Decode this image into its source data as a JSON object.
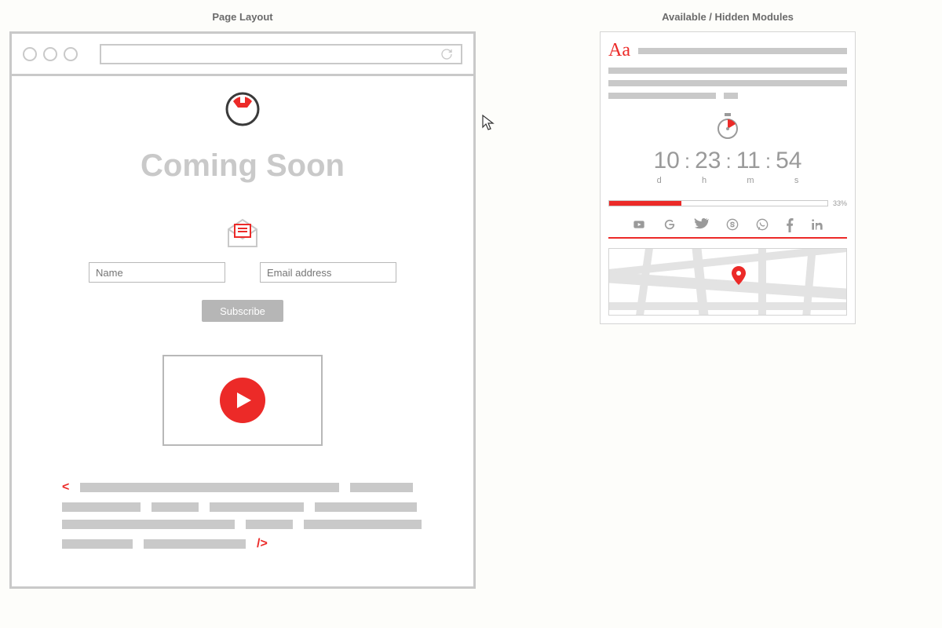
{
  "columns": {
    "layout_title": "Page Layout",
    "modules_title": "Available / Hidden Modules"
  },
  "layout": {
    "heading": "Coming Soon",
    "name_placeholder": "Name",
    "email_placeholder": "Email address",
    "subscribe_label": "Subscribe",
    "code_open": "<",
    "code_close": "/>"
  },
  "modules": {
    "text_icon": "Aa",
    "countdown": {
      "days": "10",
      "hours": "23",
      "minutes": "11",
      "seconds": "54",
      "label_d": "d",
      "label_h": "h",
      "label_m": "m",
      "label_s": "s"
    },
    "progress": {
      "percent": 33,
      "label": "33%"
    },
    "social": [
      "youtube",
      "google",
      "twitter",
      "skype",
      "whatsapp",
      "facebook",
      "linkedin"
    ]
  },
  "colors": {
    "accent": "#ec2a28",
    "muted": "#c9c9c9"
  }
}
